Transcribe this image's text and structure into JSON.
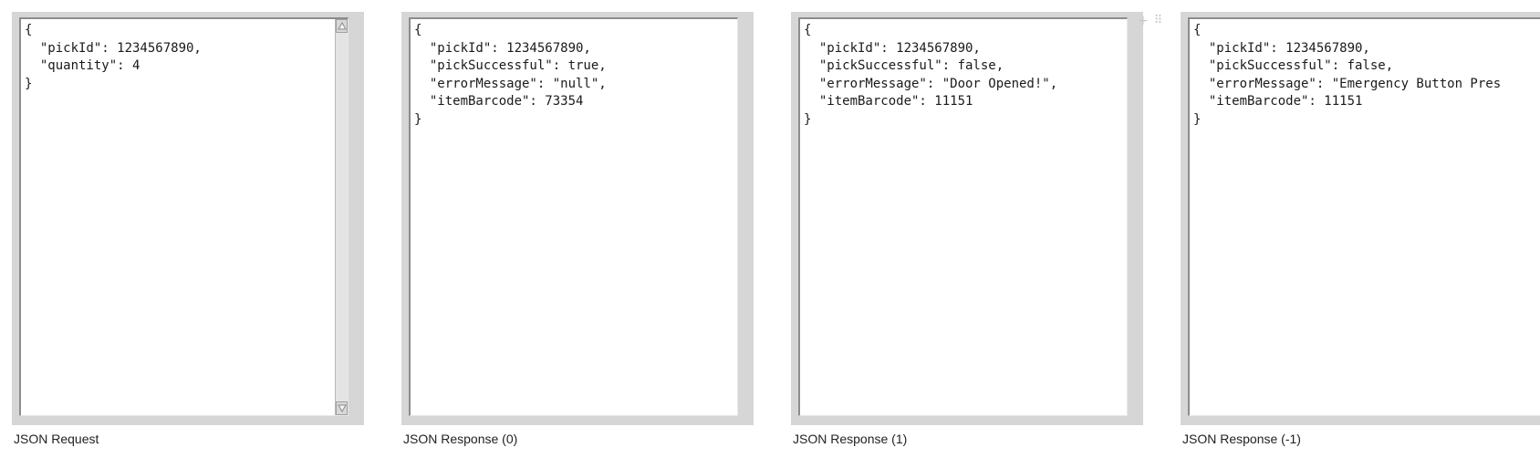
{
  "panels": [
    {
      "code": "{\n  \"pickId\": 1234567890,\n  \"quantity\": 4\n}",
      "caption": "JSON Request"
    },
    {
      "code": "{\n  \"pickId\": 1234567890,\n  \"pickSuccessful\": true,\n  \"errorMessage\": \"null\",\n  \"itemBarcode\": 73354\n}",
      "caption": "JSON Response (0)"
    },
    {
      "code": "{\n  \"pickId\": 1234567890,\n  \"pickSuccessful\": false,\n  \"errorMessage\": \"Door Opened!\",\n  \"itemBarcode\": 11151\n}",
      "caption": "JSON Response (1)"
    },
    {
      "code": "{\n  \"pickId\": 1234567890,\n  \"pickSuccessful\": false,\n  \"errorMessage\": \"Emergency Button Pres\n  \"itemBarcode\": 11151\n}",
      "caption": "JSON Response (-1)"
    }
  ],
  "toolbar": {
    "add_glyph": "+",
    "drag_glyph": "⠿"
  },
  "icons": {
    "scroll_up": "triangle-up-icon",
    "scroll_down": "triangle-down-icon",
    "add": "plus-icon",
    "drag": "drag-handle-icon"
  },
  "colors": {
    "panel_frame": "#d6d6d6",
    "editor_bg": "#ffffff",
    "text": "#1a1a1a",
    "handle": "#c8c8c8"
  }
}
